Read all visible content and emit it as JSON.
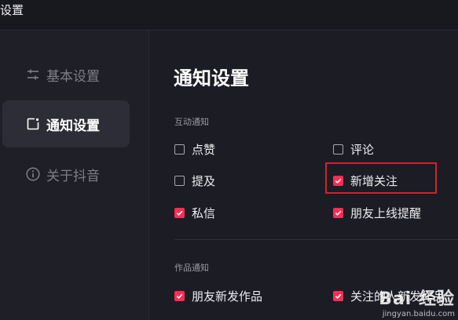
{
  "window": {
    "title": "设置"
  },
  "sidebar": {
    "items": [
      {
        "label": "基本设置",
        "icon": "sliders-icon",
        "active": false
      },
      {
        "label": "通知设置",
        "icon": "notification-icon",
        "active": true
      },
      {
        "label": "关于抖音",
        "icon": "info-icon",
        "active": false
      }
    ]
  },
  "main": {
    "title": "通知设置",
    "groups": [
      {
        "label": "互动通知",
        "options": [
          {
            "label": "点赞",
            "checked": false
          },
          {
            "label": "评论",
            "checked": false
          },
          {
            "label": "提及",
            "checked": false
          },
          {
            "label": "新增关注",
            "checked": true
          },
          {
            "label": "私信",
            "checked": true
          },
          {
            "label": "朋友上线提醒",
            "checked": true
          }
        ]
      },
      {
        "label": "作品通知",
        "options": [
          {
            "label": "朋友新发作品",
            "checked": true
          },
          {
            "label": "关注的人新发作品",
            "checked": true
          }
        ]
      }
    ]
  },
  "watermark": {
    "main": "Bai 经验",
    "sub": "jingyan.baidu.com"
  },
  "colors": {
    "accent": "#fe2c55",
    "highlight": "#d61f2b",
    "background": "#1c1c24"
  }
}
